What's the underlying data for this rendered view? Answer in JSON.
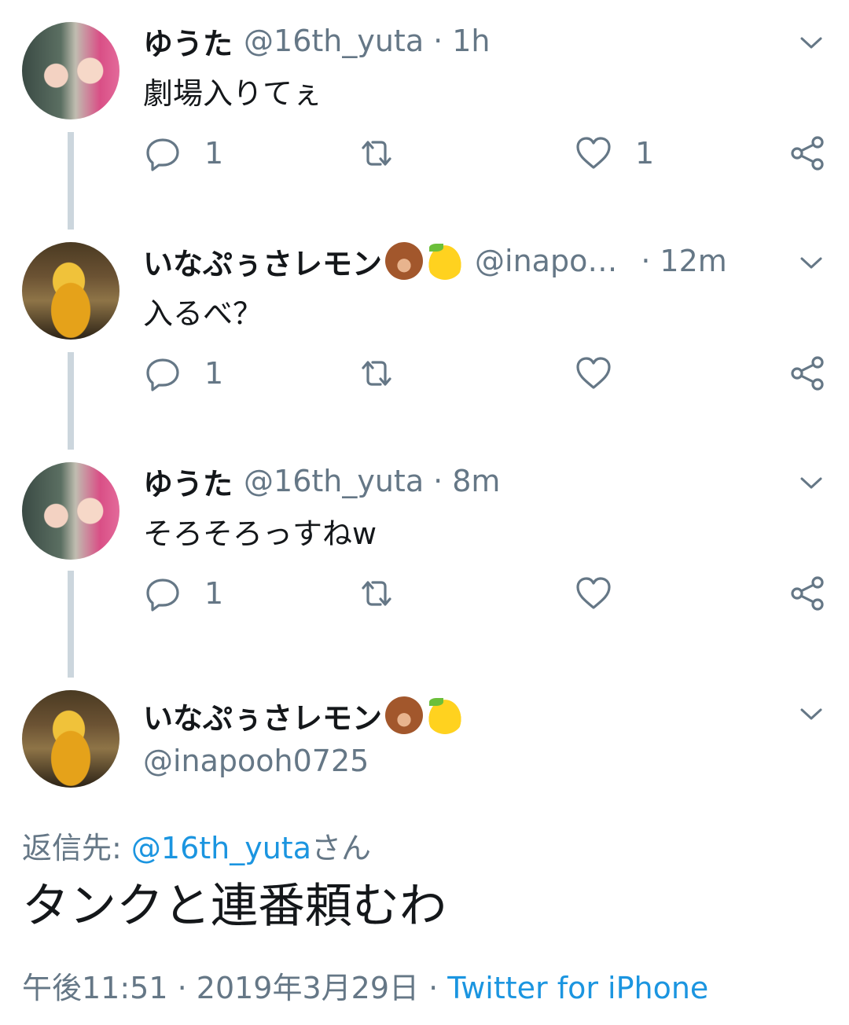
{
  "tweets": [
    {
      "name": "ゆうた",
      "handle": "@16th_yuta",
      "sep": "·",
      "time": "1h",
      "text": "劇場入りてぇ",
      "reply_count": "1",
      "like_count": "1"
    },
    {
      "name": "いなぷぅさレモン",
      "handle": "@inapo…",
      "sep": "·",
      "time": "12m",
      "text": "入るべ？",
      "reply_count": "1",
      "like_count": ""
    },
    {
      "name": "ゆうた",
      "handle": "@16th_yuta",
      "sep": "·",
      "time": "8m",
      "text": "そろそろっすねw",
      "reply_count": "1",
      "like_count": ""
    }
  ],
  "main_tweet": {
    "name": "いなぷぅさレモン",
    "handle": "@inapooh0725",
    "reply_prefix": "返信先: ",
    "reply_mention": "@16th_yuta",
    "reply_suffix": "さん",
    "text": "タンクと連番頼むわ",
    "time": "午後11:51",
    "sep1": " · ",
    "date": "2019年3月29日",
    "sep2": " · ",
    "source": "Twitter for iPhone"
  },
  "name_emojis": [
    "bear-face",
    "lemon"
  ],
  "colors": {
    "text": "#14171a",
    "secondary": "#657786",
    "link": "#1b95e0",
    "thread_line": "#ccd6dd"
  }
}
